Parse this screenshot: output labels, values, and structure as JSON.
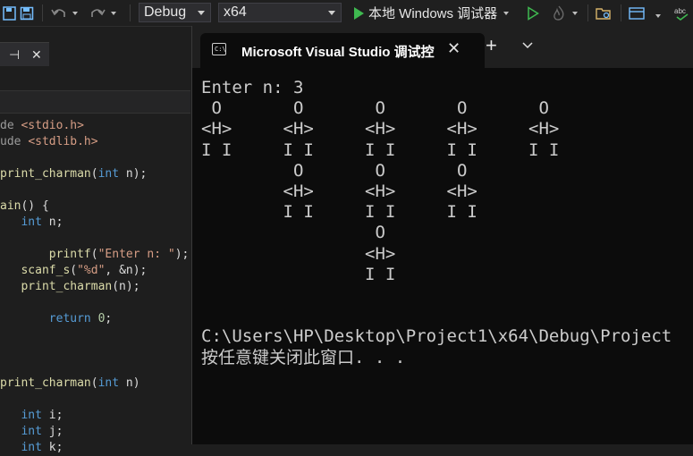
{
  "toolbar": {
    "config": "Debug",
    "platform": "x64",
    "run_label": "本地 Windows 调试器",
    "icons": [
      "save-all-icon",
      "save-icon",
      "undo-icon",
      "redo-icon",
      "play-icon",
      "start-without-debug-icon",
      "hot-reload-icon",
      "file-explorer-icon",
      "window-layout-icon",
      "spelling-icon"
    ],
    "accent": "#3fb950"
  },
  "editor": {
    "tab_controls": {
      "pin": "⊣",
      "close": "✕"
    },
    "lines": [
      {
        "parts": [
          {
            "t": "de ",
            "c": "macro"
          },
          {
            "t": "<stdio.h>",
            "c": "str"
          }
        ]
      },
      {
        "parts": [
          {
            "t": "ude ",
            "c": "macro"
          },
          {
            "t": "<stdlib.h>",
            "c": "str"
          }
        ]
      },
      {
        "parts": []
      },
      {
        "parts": [
          {
            "t": "print_charman",
            "c": "fn"
          },
          {
            "t": "(",
            "c": "pl"
          },
          {
            "t": "int",
            "c": "kw"
          },
          {
            "t": " n);",
            "c": "pl"
          }
        ]
      },
      {
        "parts": []
      },
      {
        "parts": [
          {
            "t": "ain",
            "c": "fn"
          },
          {
            "t": "() {",
            "c": "pl"
          }
        ]
      },
      {
        "parts": [
          {
            "t": "   ",
            "c": "pl"
          },
          {
            "t": "int",
            "c": "kw"
          },
          {
            "t": " n;",
            "c": "pl"
          }
        ]
      },
      {
        "parts": []
      },
      {
        "parts": [
          {
            "t": "       ",
            "c": "pl"
          },
          {
            "t": "printf",
            "c": "fn"
          },
          {
            "t": "(",
            "c": "pl"
          },
          {
            "t": "\"Enter n: \"",
            "c": "str"
          },
          {
            "t": ");",
            "c": "pl"
          }
        ]
      },
      {
        "parts": [
          {
            "t": "   ",
            "c": "pl"
          },
          {
            "t": "scanf_s",
            "c": "fn"
          },
          {
            "t": "(",
            "c": "pl"
          },
          {
            "t": "\"%d\"",
            "c": "str"
          },
          {
            "t": ", &n);",
            "c": "pl"
          }
        ]
      },
      {
        "parts": [
          {
            "t": "   ",
            "c": "pl"
          },
          {
            "t": "print_charman",
            "c": "fn"
          },
          {
            "t": "(n);",
            "c": "pl"
          }
        ]
      },
      {
        "parts": []
      },
      {
        "parts": [
          {
            "t": "       ",
            "c": "pl"
          },
          {
            "t": "return",
            "c": "kw"
          },
          {
            "t": " ",
            "c": "pl"
          },
          {
            "t": "0",
            "c": "num"
          },
          {
            "t": ";",
            "c": "pl"
          }
        ]
      },
      {
        "parts": []
      },
      {
        "parts": []
      },
      {
        "parts": []
      },
      {
        "parts": [
          {
            "t": "print_charman",
            "c": "fn"
          },
          {
            "t": "(",
            "c": "pl"
          },
          {
            "t": "int",
            "c": "kw"
          },
          {
            "t": " n)",
            "c": "pl"
          }
        ]
      },
      {
        "parts": []
      },
      {
        "parts": [
          {
            "t": "   ",
            "c": "pl"
          },
          {
            "t": "int",
            "c": "kw"
          },
          {
            "t": " i;",
            "c": "pl"
          }
        ]
      },
      {
        "parts": [
          {
            "t": "   ",
            "c": "pl"
          },
          {
            "t": "int",
            "c": "kw"
          },
          {
            "t": " j;",
            "c": "pl"
          }
        ]
      },
      {
        "parts": [
          {
            "t": "   ",
            "c": "pl"
          },
          {
            "t": "int",
            "c": "kw"
          },
          {
            "t": " k;",
            "c": "pl"
          }
        ]
      }
    ]
  },
  "terminal": {
    "tab_title": "Microsoft Visual Studio 调试控",
    "new_tab": "+",
    "lines": [
      "Enter n: 3",
      " O       O       O       O       O",
      "<H>     <H>     <H>     <H>     <H>",
      "I I     I I     I I     I I     I I",
      "         O       O       O",
      "        <H>     <H>     <H>",
      "        I I     I I     I I",
      "                 O",
      "                <H>",
      "                I I",
      "",
      "",
      "C:\\Users\\HP\\Desktop\\Project1\\x64\\Debug\\Project",
      "按任意键关闭此窗口. . ."
    ]
  }
}
